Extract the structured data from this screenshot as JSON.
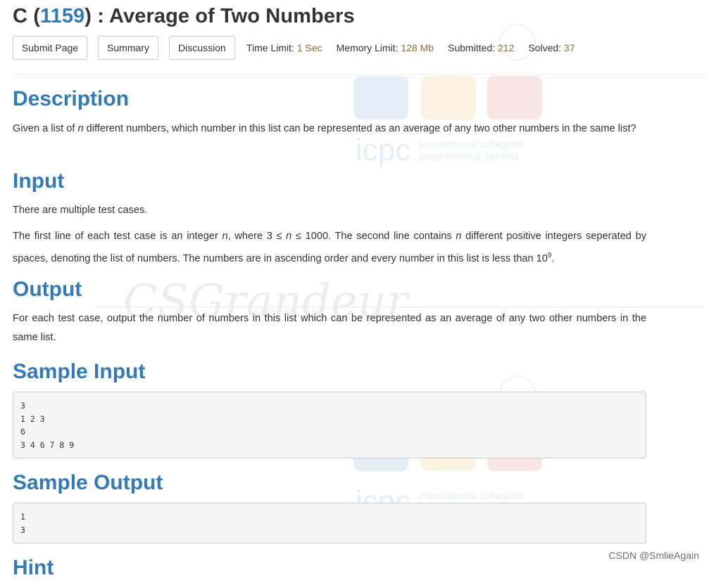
{
  "header": {
    "title_prefix": "C (",
    "problem_id": "1159",
    "title_suffix": ") : Average of Two Numbers",
    "buttons": {
      "submit": "Submit Page",
      "summary": "Summary",
      "discussion": "Discussion"
    },
    "meta": {
      "time_label": "Time Limit:",
      "time_value": "1 Sec",
      "memory_label": "Memory Limit:",
      "memory_value": "128 Mb",
      "submitted_label": "Submitted:",
      "submitted_value": "212",
      "solved_label": "Solved:",
      "solved_value": "37"
    }
  },
  "description": {
    "heading": "Description",
    "text_1": "Given a list of ",
    "var_n": "n",
    "text_2": " different numbers, which number in this list can be represented as an average of any two other numbers in the same list?"
  },
  "input": {
    "heading": "Input",
    "p1": "There are multiple test cases.",
    "p2_a": "The first line of each test case is an integer ",
    "p2_n1": "n",
    "p2_b": ", where 3 ≤ ",
    "p2_n2": "n",
    "p2_c": " ≤ 1000. The second line contains ",
    "p2_n3": "n",
    "p2_d": " different positive integers seperated by spaces, denoting the list of numbers. The numbers are in ascending order and every number in this list is less than 10",
    "p2_exp": "9",
    "p2_e": "."
  },
  "output": {
    "heading": "Output",
    "text": "For each test case, output the number of numbers in this list which can be represented as an average of any two other numbers in the same list."
  },
  "sample_input": {
    "heading": "Sample Input",
    "code": "3\n1 2 3\n6\n3 4 6 7 8 9"
  },
  "sample_output": {
    "heading": "Sample Output",
    "code": "1\n3"
  },
  "hint": {
    "heading": "Hint"
  },
  "watermark": {
    "icpc_text": "icpc",
    "icpc_line1": "international collegiate",
    "icpc_line2": "programming contest",
    "signature": "CSGrandeur",
    "colors": {
      "blue": "#337ab7",
      "gold": "#e8a318",
      "red": "#c9302c"
    }
  },
  "footer": {
    "csdn": "CSDN @SmlieAgain"
  }
}
